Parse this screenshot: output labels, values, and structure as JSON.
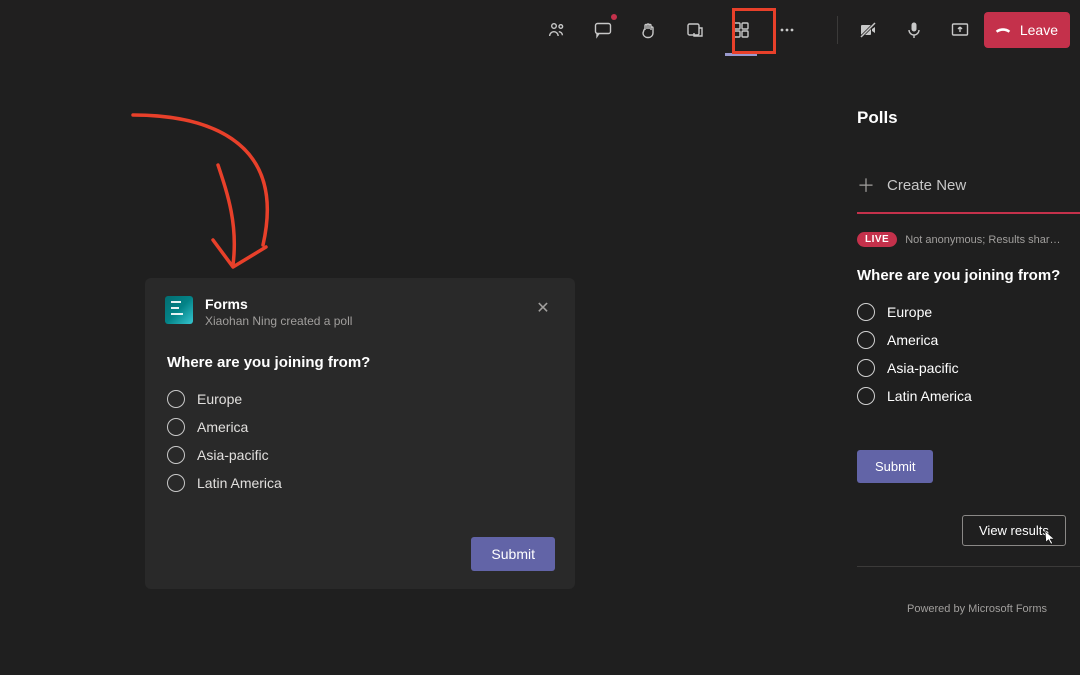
{
  "toolbar": {
    "leave_label": "Leave"
  },
  "annotation": {
    "highlight_target": "forms-toolbar-icon"
  },
  "poll_card": {
    "app_name": "Forms",
    "subtitle": "Xiaohan Ning created a poll",
    "question": "Where are you joining from?",
    "options": [
      "Europe",
      "America",
      "Asia-pacific",
      "Latin America"
    ],
    "submit_label": "Submit"
  },
  "panel": {
    "title": "Polls",
    "create_label": "Create New",
    "live_badge": "LIVE",
    "meta": "Not anonymous; Results shar…",
    "question": "Where are you joining from?",
    "options": [
      "Europe",
      "America",
      "Asia-pacific",
      "Latin America"
    ],
    "submit_label": "Submit",
    "view_results_label": "View results",
    "footer": "Powered by Microsoft Forms"
  }
}
